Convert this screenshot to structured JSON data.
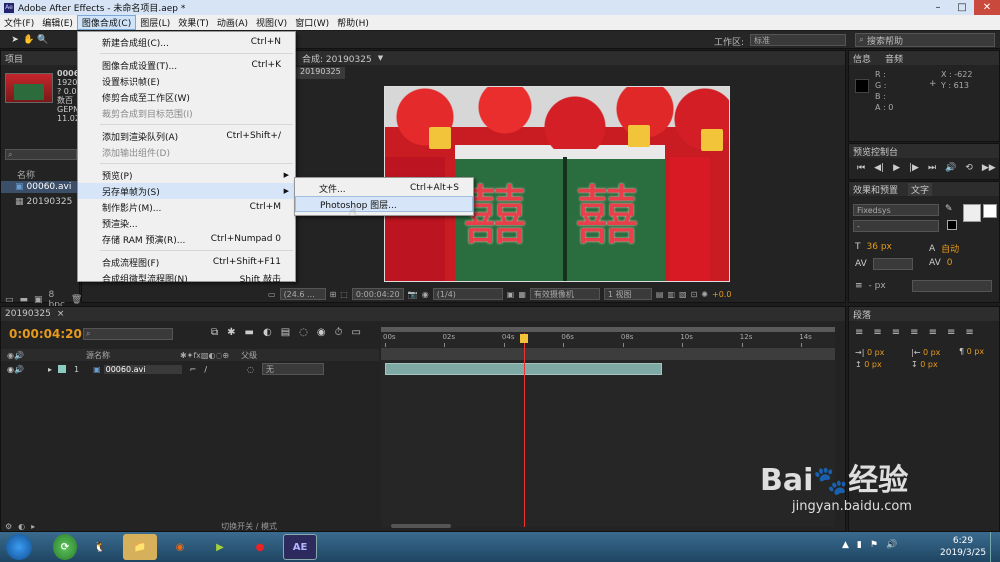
{
  "title_bar": {
    "text": "Adobe After Effects - 未命名项目.aep *"
  },
  "menu_bar": {
    "items": [
      "文件(F)",
      "编辑(E)",
      "图像合成(C)",
      "图层(L)",
      "效果(T)",
      "动画(A)",
      "视图(V)",
      "窗口(W)",
      "帮助(H)"
    ]
  },
  "toolbar": {
    "workspace_label": "工作区:",
    "workspace_value": "标准",
    "search_placeholder": "搜索帮助"
  },
  "project_panel": {
    "tab": "项目",
    "asset_name": "00060",
    "asset_meta": [
      "1920",
      "? 0.00",
      "数百",
      "GEPN",
      "11.02"
    ],
    "column_name": "名称",
    "items": [
      "00060.avi",
      "20190325"
    ],
    "bpc": "8 bpc"
  },
  "comp_panel": {
    "tab": "合成: 20190325",
    "comp_tab": "20190325",
    "footer": {
      "zoom": "(24.6 ...",
      "timecode": "0:00:04:20",
      "resolution": "(1/4)",
      "camera": "有效摄像机",
      "views": "1 视图",
      "exposure": "+0.0"
    },
    "image_text_left": "囍",
    "image_text_right": "囍"
  },
  "info_panel": {
    "tabs": [
      "信息",
      "音频"
    ],
    "r_label": "R :",
    "g_label": "G :",
    "b_label": "B :",
    "a_label": "A : 0",
    "x": "X : -622",
    "y": "Y : 613"
  },
  "preview_panel": {
    "tab": "预览控制台"
  },
  "char_panel": {
    "tabs": [
      "效果和预置",
      "文字"
    ],
    "font": "Fixedsys",
    "style": "-",
    "size": "36 px",
    "leading": "自动",
    "tracking": "0",
    "baseline": "- px"
  },
  "para_panel": {
    "tab": "段落",
    "values": [
      "0 px",
      "0 px",
      "0 px",
      "0 px",
      "0 px"
    ]
  },
  "timeline": {
    "tab": "20190325",
    "timecode": "0:00:04:20",
    "col_source": "源名称",
    "col_parent": "父级",
    "layer_number": "1",
    "layer_name": "00060.avi",
    "parent_value": "无",
    "ruler": [
      "00s",
      "02s",
      "04s",
      "06s",
      "08s",
      "10s",
      "12s",
      "14s"
    ],
    "footer_label": "切换开关 / 模式",
    "playhead_seconds": 4.67,
    "clip_end_seconds": 9.3,
    "total_seconds": 15
  },
  "menu_composition": {
    "items": [
      {
        "label": "新建合成组(C)...",
        "shortcut": "Ctrl+N",
        "state": "normal"
      },
      {
        "sep": true
      },
      {
        "label": "图像合成设置(T)...",
        "shortcut": "Ctrl+K",
        "state": "normal"
      },
      {
        "label": "设置标识帧(E)",
        "shortcut": "",
        "state": "normal"
      },
      {
        "label": "修剪合成至工作区(W)",
        "shortcut": "",
        "state": "normal"
      },
      {
        "label": "裁剪合成到目标范围(I)",
        "shortcut": "",
        "state": "disabled"
      },
      {
        "sep": true
      },
      {
        "label": "添加到渲染队列(A)",
        "shortcut": "Ctrl+Shift+/",
        "state": "normal"
      },
      {
        "label": "添加输出组件(D)",
        "shortcut": "",
        "state": "disabled"
      },
      {
        "sep": true
      },
      {
        "label": "预览(P)",
        "shortcut": "",
        "state": "submenu"
      },
      {
        "label": "另存单帧为(S)",
        "shortcut": "",
        "state": "submenu-open"
      },
      {
        "label": "制作影片(M)...",
        "shortcut": "Ctrl+M",
        "state": "normal"
      },
      {
        "label": "预渲染...",
        "shortcut": "",
        "state": "normal"
      },
      {
        "label": "存储 RAM 预演(R)...",
        "shortcut": "Ctrl+Numpad 0",
        "state": "normal"
      },
      {
        "sep": true
      },
      {
        "label": "合成流程图(F)",
        "shortcut": "Ctrl+Shift+F11",
        "state": "normal"
      },
      {
        "label": "合成组微型流程图(N)",
        "shortcut": "Shift 敲击",
        "state": "normal"
      }
    ]
  },
  "submenu_save_frame": {
    "items": [
      {
        "label": "文件...",
        "shortcut": "Ctrl+Alt+S"
      },
      {
        "label": "Photoshop 图层...",
        "shortcut": ""
      }
    ]
  },
  "watermark": {
    "brand": "Bai",
    "brand_cn": "经验",
    "url": "jingyan.baidu.com"
  },
  "taskbar": {
    "time": "6:29",
    "date": "2019/3/25",
    "ae_label": "AE"
  }
}
